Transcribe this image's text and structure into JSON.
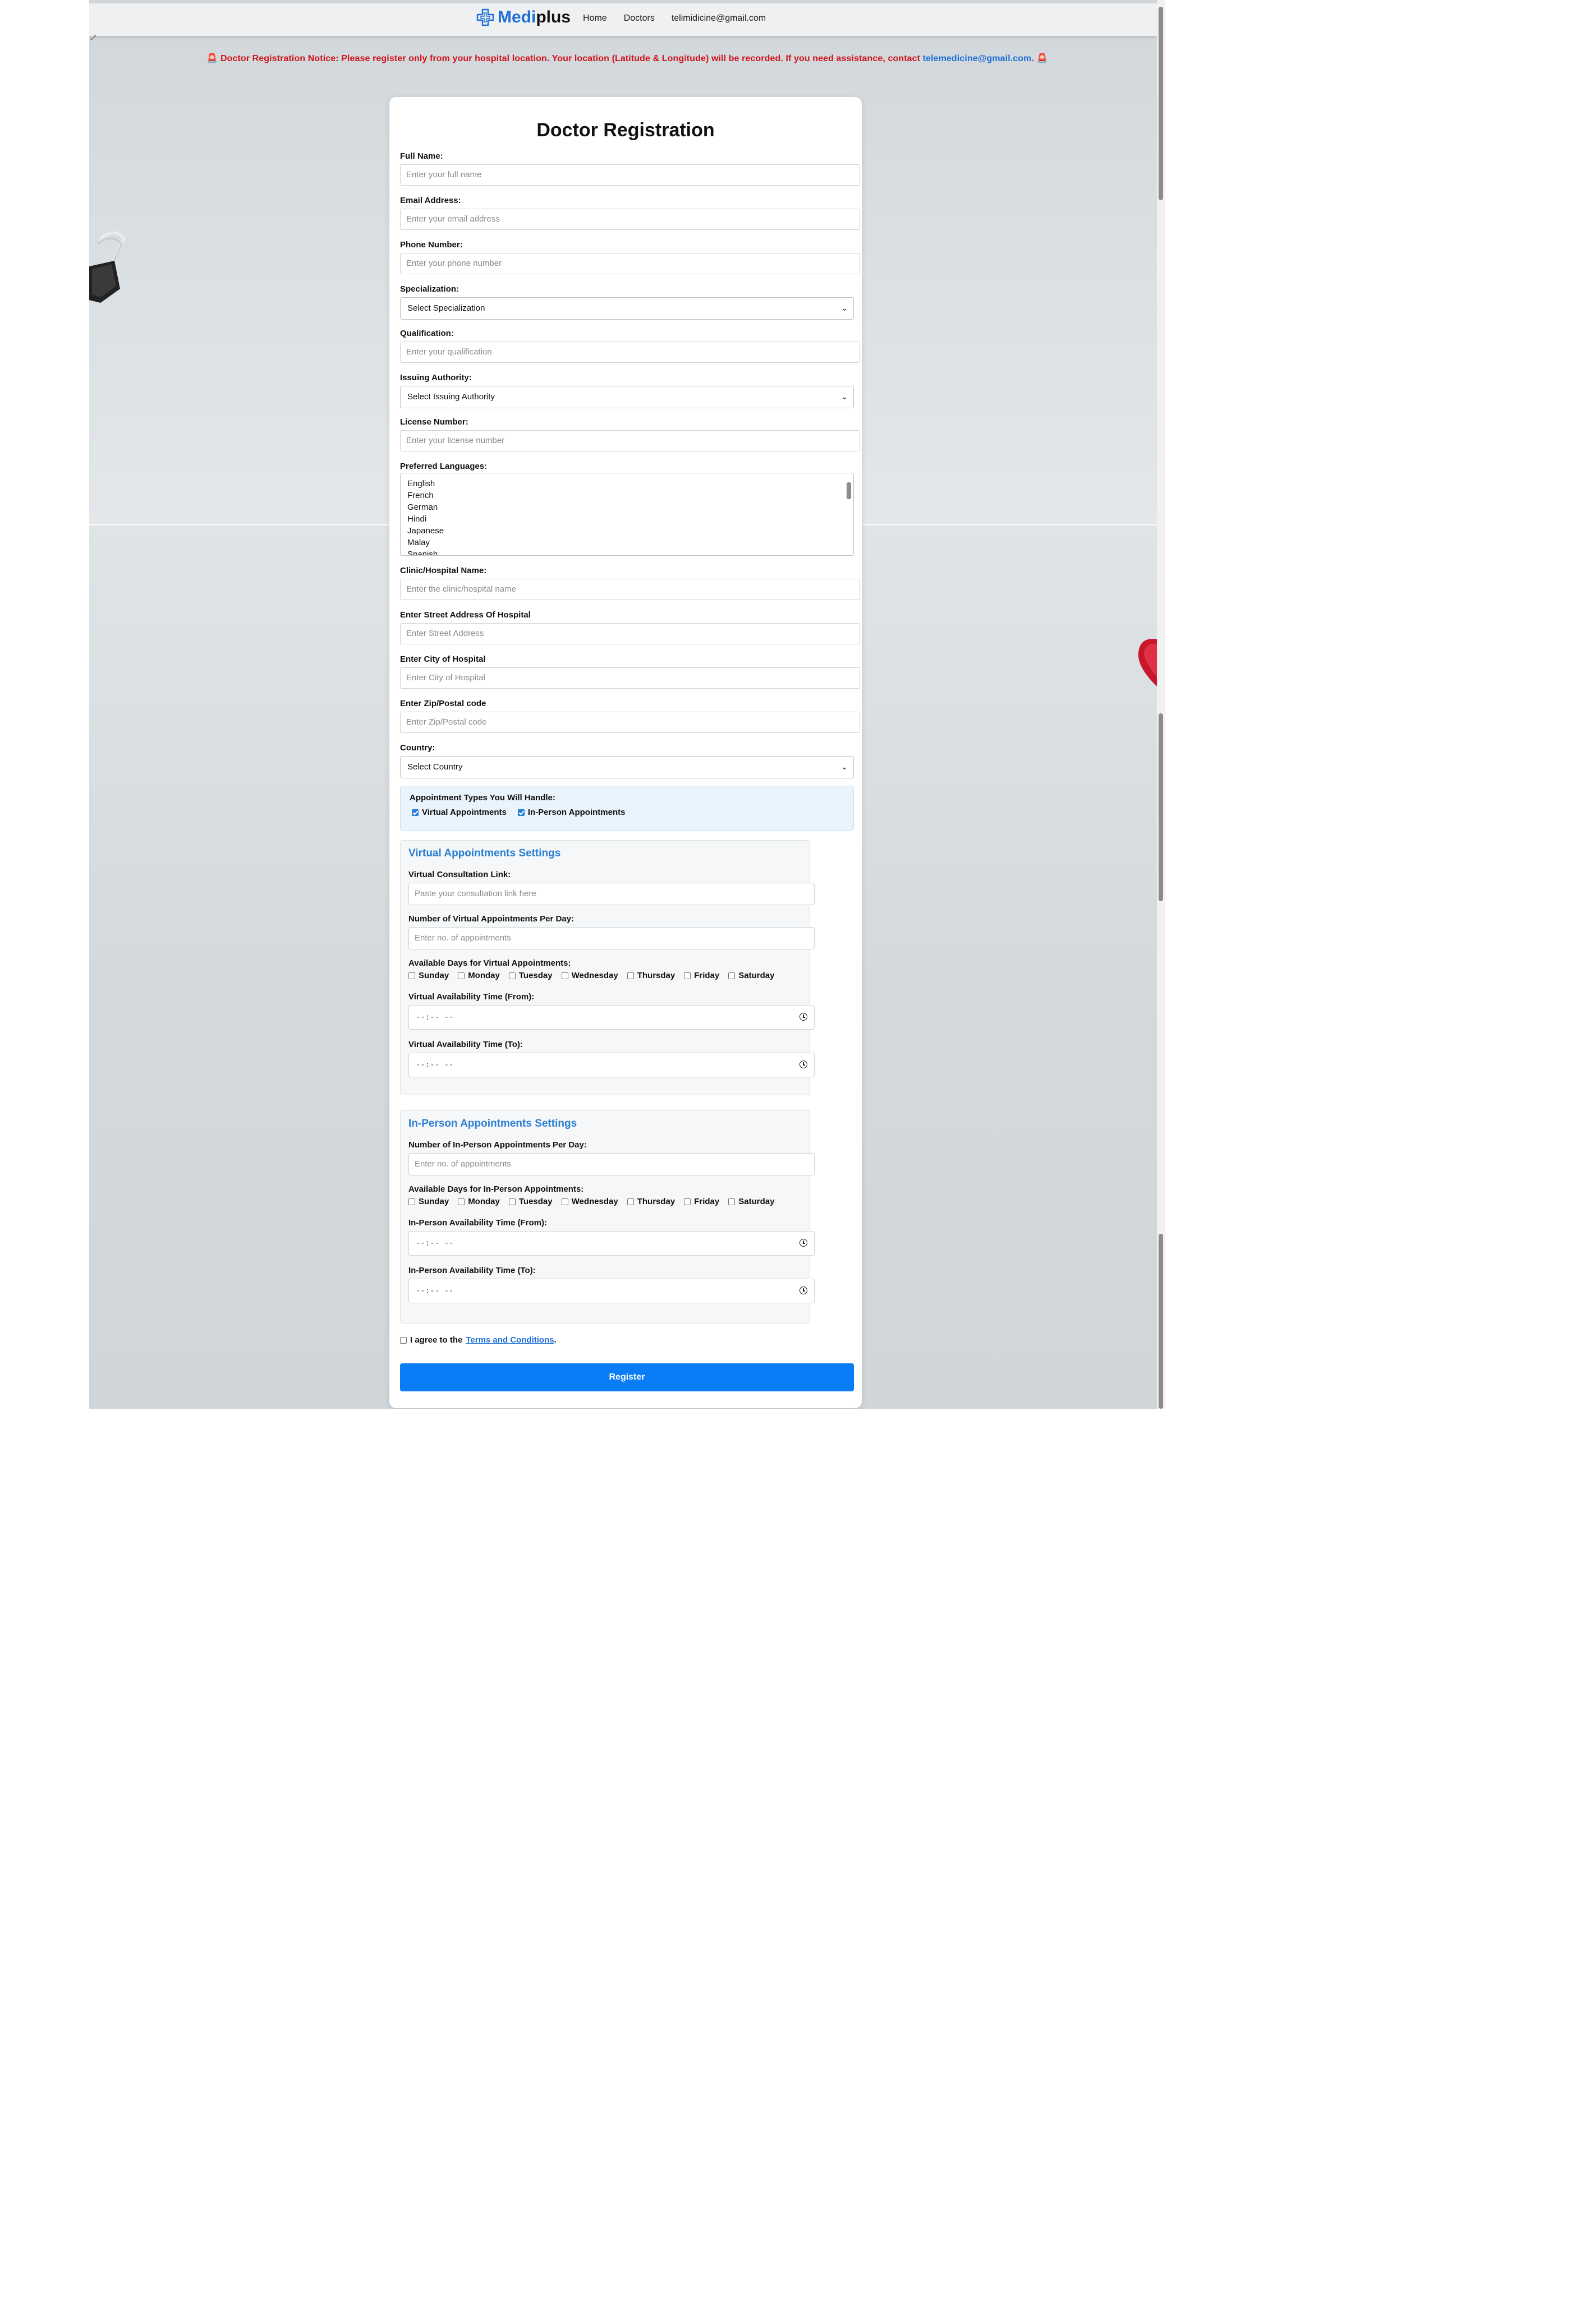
{
  "nav": {
    "brand_first": "Medi",
    "brand_second": "plus",
    "links": [
      "Home",
      "Doctors",
      "telimidicine@gmail.com"
    ]
  },
  "notice": {
    "icon": "🚨",
    "heading": "Doctor Registration Notice:",
    "text": "Please register only from your hospital location. Your location (Latitude & Longitude) will be recorded. If you need assistance, contact",
    "email": "telemedicine@gmail.com",
    "period": "."
  },
  "form": {
    "title": "Doctor Registration",
    "full_name": {
      "label": "Full Name:",
      "placeholder": "Enter your full name"
    },
    "email": {
      "label": "Email Address:",
      "placeholder": "Enter your email address"
    },
    "phone": {
      "label": "Phone Number:",
      "placeholder": "Enter your phone number"
    },
    "specialization": {
      "label": "Specialization:",
      "value": "Select Specialization"
    },
    "qualification": {
      "label": "Qualification:",
      "placeholder": "Enter your qualification"
    },
    "issuing_authority": {
      "label": "Issuing Authority:",
      "value": "Select Issuing Authority"
    },
    "license": {
      "label": "License Number:",
      "placeholder": "Enter your license number"
    },
    "languages": {
      "label": "Preferred Languages:",
      "options": [
        "English",
        "French",
        "German",
        "Hindi",
        "Japanese",
        "Malay",
        "Spanish"
      ]
    },
    "clinic": {
      "label": "Clinic/Hospital Name:",
      "placeholder": "Enter the clinic/hospital name"
    },
    "street": {
      "label": "Enter Street Address Of Hospital",
      "placeholder": "Enter Street Address"
    },
    "city": {
      "label": "Enter City of Hospital",
      "placeholder": "Enter City of Hospital"
    },
    "zip": {
      "label": "Enter Zip/Postal code",
      "placeholder": "Enter Zip/Postal code"
    },
    "country": {
      "label": "Country:",
      "value": "Select Country"
    },
    "appointment_types": {
      "label": "Appointment Types You Will Handle:",
      "virtual": {
        "label": "Virtual Appointments",
        "checked": true
      },
      "in_person": {
        "label": "In-Person Appointments",
        "checked": true
      }
    },
    "virtual_settings": {
      "title": "Virtual Appointments Settings",
      "link_label": "Virtual Consultation Link:",
      "link_placeholder": "Paste your consultation link here",
      "per_day_label": "Number of Virtual Appointments Per Day:",
      "per_day_placeholder": "Enter no. of appointments",
      "days_label": "Available Days for Virtual Appointments:",
      "from_label": "Virtual Availability Time (From):",
      "to_label": "Virtual Availability Time (To):",
      "time_placeholder": "--:-- --"
    },
    "inperson_settings": {
      "title": "In-Person Appointments Settings",
      "per_day_label": "Number of In-Person Appointments Per Day:",
      "per_day_placeholder": "Enter no. of appointments",
      "days_label": "Available Days for In-Person Appointments:",
      "from_label": "In-Person Availability Time (From):",
      "to_label": "In-Person Availability Time (To):",
      "time_placeholder": "--:-- --"
    },
    "days": [
      "Sunday",
      "Monday",
      "Tuesday",
      "Wednesday",
      "Thursday",
      "Friday",
      "Saturday"
    ],
    "terms": {
      "prefix": "I agree to the",
      "link": "Terms and Conditions",
      "suffix": "."
    },
    "register_label": "Register"
  },
  "colors": {
    "accent": "#0a7cf5",
    "notice": "#d0141a",
    "section_title": "#2a7fd4"
  }
}
